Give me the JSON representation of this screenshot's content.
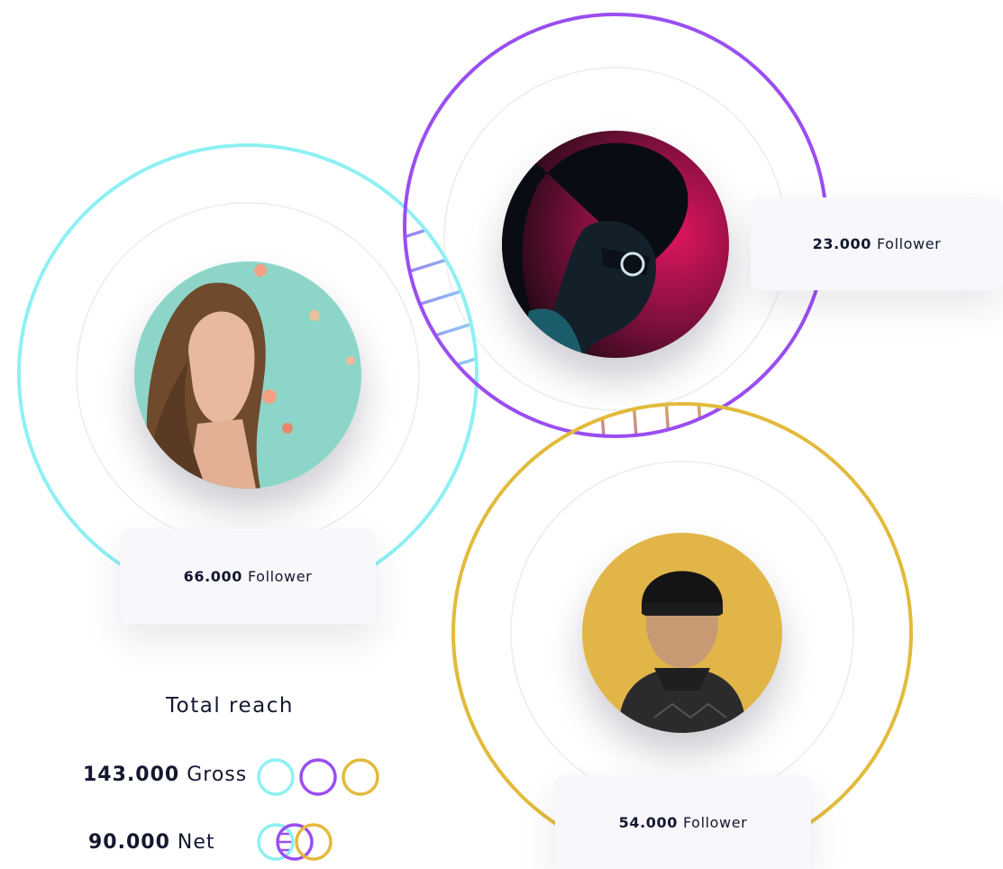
{
  "profiles": [
    {
      "id": "profile-left",
      "ring_color": "#8ef0f3",
      "followers_value": "66.000",
      "followers_label": "Follower"
    },
    {
      "id": "profile-top",
      "ring_color": "#9a4ef0",
      "followers_value": "23.000",
      "followers_label": "Follower"
    },
    {
      "id": "profile-bottom",
      "ring_color": "#e2bb3c",
      "followers_value": "54.000",
      "followers_label": "Follower"
    }
  ],
  "total_reach": {
    "title": "Total reach",
    "gross_value": "143.000",
    "gross_label": "Gross",
    "net_value": "90.000",
    "net_label": "Net"
  },
  "colors": {
    "text": "#14182e",
    "card_bg": "#f8f8fc",
    "inner_ring": "#ececf0"
  }
}
